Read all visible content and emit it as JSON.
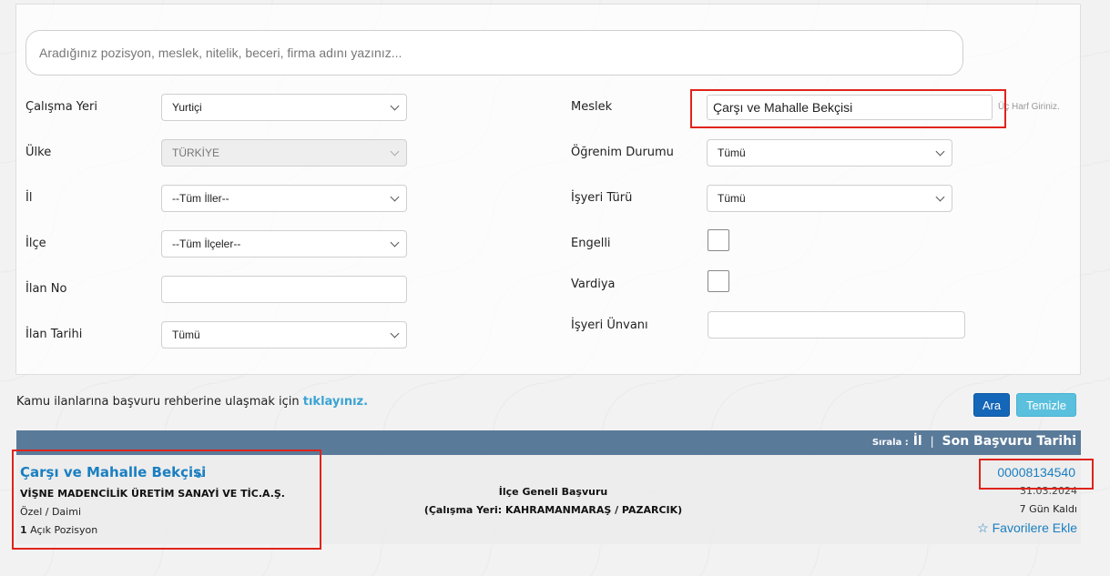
{
  "search": {
    "placeholder": "Aradığınız pozisyon, meslek, nitelik, beceri, firma adını yazınız..."
  },
  "filters": {
    "calisma_yeri": {
      "label": "Çalışma Yeri",
      "value": "Yurtiçi"
    },
    "ulke": {
      "label": "Ülke",
      "value": "TÜRKİYE"
    },
    "il": {
      "label": "İl",
      "value": "--Tüm İller--"
    },
    "ilce": {
      "label": "İlçe",
      "value": "--Tüm İlçeler--"
    },
    "ilan_no": {
      "label": "İlan No",
      "value": ""
    },
    "ilan_tarihi": {
      "label": "İlan Tarihi",
      "value": "Tümü"
    },
    "meslek": {
      "label": "Meslek",
      "value": "Çarşı ve Mahalle Bekçisi",
      "hint": "Üç Harf Giriniz."
    },
    "ogrenim": {
      "label": "Öğrenim Durumu",
      "value": "Tümü"
    },
    "isyeri_turu": {
      "label": "İşyeri Türü",
      "value": "Tümü"
    },
    "engelli": {
      "label": "Engelli"
    },
    "vardiya": {
      "label": "Vardiya"
    },
    "isyeri_unvani": {
      "label": "İşyeri Ünvanı",
      "value": ""
    }
  },
  "info": {
    "text": "Kamu ilanlarına başvuru rehberine ulaşmak için ",
    "link": "tıklayınız."
  },
  "buttons": {
    "ara": "Ara",
    "temizle": "Temizle"
  },
  "sort": {
    "prefix": "Sırala :",
    "il": "İl",
    "separator": "|",
    "son_basvuru": "Son Başvuru Tarihi"
  },
  "results": [
    {
      "title": "Çarşı ve Mahalle Bekçisi",
      "company": "VİŞNE MADENCİLİK ÜRETİM SANAYİ VE TİC.A.Ş.",
      "type": "Özel / Daimi",
      "position_count": "1",
      "position_text": " Açık Pozisyon",
      "scope": "İlçe Geneli Başvuru",
      "location": "(Çalışma Yeri: KAHRAMANMARAŞ / PAZARCIK)",
      "ilan_no": "00008134540",
      "date": "31.03.2024",
      "days_left": "7 Gün Kaldı",
      "favorite": "Favorilere Ekle"
    }
  ],
  "highlight_color": "#e0231b"
}
